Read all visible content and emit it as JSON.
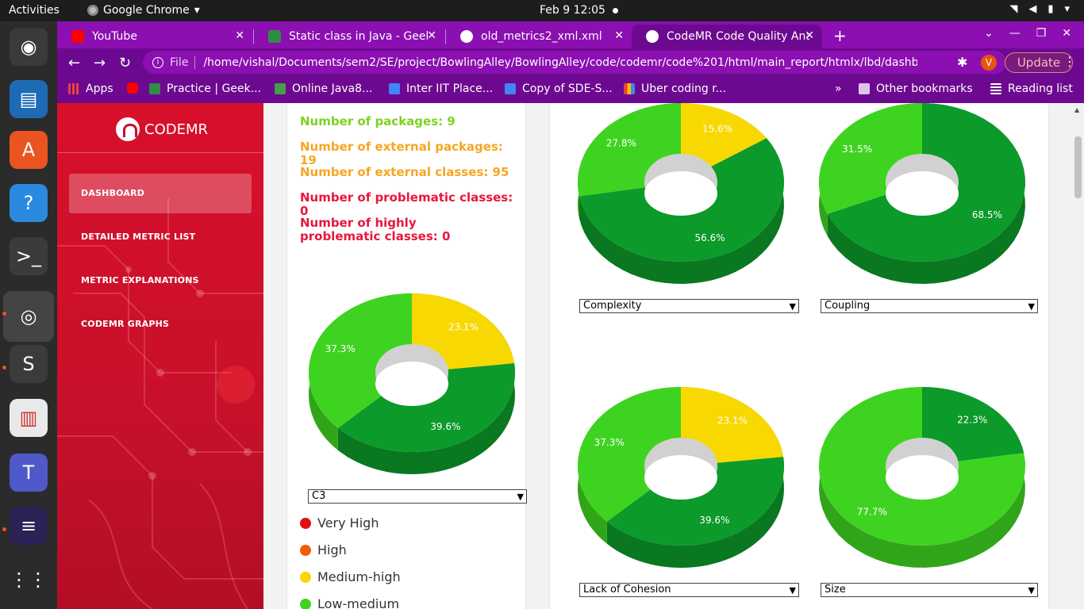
{
  "system": {
    "activities": "Activities",
    "app_name": "Google Chrome",
    "clock": "Feb 9  12:05"
  },
  "dock": [
    {
      "name": "rhythmbox-icon",
      "color": "#3a3a3a",
      "glyph": "◉"
    },
    {
      "name": "writer-icon",
      "color": "#1d6bb5",
      "glyph": "▤"
    },
    {
      "name": "software-icon",
      "color": "#e95420",
      "glyph": "A"
    },
    {
      "name": "help-icon",
      "color": "#2a8adf",
      "glyph": "?"
    },
    {
      "name": "terminal-icon",
      "color": "#3b3b3b",
      "glyph": ">_"
    },
    {
      "name": "chrome-icon",
      "color": "#444",
      "glyph": "◎"
    },
    {
      "name": "sublime-icon",
      "color": "#3b3b3b",
      "glyph": "S"
    },
    {
      "name": "reader-icon",
      "color": "#e9e9e9",
      "glyph": "▥"
    },
    {
      "name": "teams-icon",
      "color": "#5059c9",
      "glyph": "T"
    },
    {
      "name": "eclipse-icon",
      "color": "#2c2255",
      "glyph": "≡"
    },
    {
      "name": "app-grid-icon",
      "color": "#2b2b2b",
      "glyph": "⋮⋮"
    }
  ],
  "tabs": [
    {
      "title": "YouTube",
      "icon_color": "#ff0000"
    },
    {
      "title": "Static class in Java - Geeks",
      "icon_color": "#2f8d46"
    },
    {
      "title": "old_metrics2_xml.xml",
      "icon_color": "#ffffff"
    },
    {
      "title": "CodeMR Code Quality Ana",
      "icon_color": "#ffffff"
    }
  ],
  "address": {
    "scheme_label": "File",
    "url": "/home/vishal/Documents/sem2/SE/project/BowlingAlley/BowlingAlley/code/codemr/code%201/html/main_report/htmlx/lbd/dashboard.html",
    "avatar": "V",
    "update_label": "Update"
  },
  "bookmarks": [
    {
      "label": "Apps",
      "color": "#ea4335"
    },
    {
      "label": "",
      "color": "#ff0000"
    },
    {
      "label": "Practice | Geek...",
      "color": "#2f8d46"
    },
    {
      "label": "Online Java8...",
      "color": "#43a047"
    },
    {
      "label": "Inter IIT Place...",
      "color": "#4285f4"
    },
    {
      "label": "Copy of SDE-S...",
      "color": "#4285f4"
    },
    {
      "label": "Uber coding r...",
      "color": "#fbbc04"
    }
  ],
  "bookmarks_more": "»",
  "other_bookmarks": "Other bookmarks",
  "reading_list": "Reading list",
  "sidebar": {
    "brand": "CODEMR",
    "items": [
      {
        "label": "DASHBOARD",
        "active": true
      },
      {
        "label": "DETAILED METRIC LIST",
        "active": false
      },
      {
        "label": "METRIC EXPLANATIONS",
        "active": false
      },
      {
        "label": "CODEMR GRAPHS",
        "active": false
      }
    ]
  },
  "stats": [
    {
      "text": "Number of packages: 9",
      "color": "#7ed321"
    },
    {
      "text": "Number of external packages: 19",
      "color": "#f5a623"
    },
    {
      "text": "Number of external classes: 95",
      "color": "#f5a623"
    },
    {
      "text": "Number of problematic classes: 0",
      "color": "#e8173d"
    },
    {
      "text": "Number of highly problematic classes: 0",
      "color": "#e8173d"
    }
  ],
  "legend": [
    {
      "label": "Very High",
      "color": "#e01010"
    },
    {
      "label": "High",
      "color": "#f25c05"
    },
    {
      "label": "Medium-high",
      "color": "#f7d800"
    },
    {
      "label": "Low-medium",
      "color": "#3fd321"
    }
  ],
  "chart_data": [
    {
      "type": "pie",
      "selector": "C3",
      "slices": [
        {
          "value": 23.1,
          "label": "23.1%",
          "color": "#f7d800"
        },
        {
          "value": 39.6,
          "label": "39.6%",
          "color": "#0c9a2a"
        },
        {
          "value": 37.3,
          "label": "37.3%",
          "color": "#3fd321"
        }
      ]
    },
    {
      "type": "pie",
      "selector": "Complexity",
      "slices": [
        {
          "value": 15.6,
          "label": "15.6%",
          "color": "#f7d800"
        },
        {
          "value": 56.6,
          "label": "56.6%",
          "color": "#0c9a2a"
        },
        {
          "value": 27.8,
          "label": "27.8%",
          "color": "#3fd321"
        }
      ]
    },
    {
      "type": "pie",
      "selector": "Coupling",
      "slices": [
        {
          "value": 68.5,
          "label": "68.5%",
          "color": "#0c9a2a"
        },
        {
          "value": 31.5,
          "label": "31.5%",
          "color": "#3fd321"
        }
      ]
    },
    {
      "type": "pie",
      "selector": "Lack of Cohesion",
      "slices": [
        {
          "value": 23.1,
          "label": "23.1%",
          "color": "#f7d800"
        },
        {
          "value": 39.6,
          "label": "39.6%",
          "color": "#0c9a2a"
        },
        {
          "value": 37.3,
          "label": "37.3%",
          "color": "#3fd321"
        }
      ]
    },
    {
      "type": "pie",
      "selector": "Size",
      "slices": [
        {
          "value": 22.3,
          "label": "22.3%",
          "color": "#0c9a2a"
        },
        {
          "value": 77.7,
          "label": "77.7%",
          "color": "#3fd321"
        }
      ]
    }
  ]
}
